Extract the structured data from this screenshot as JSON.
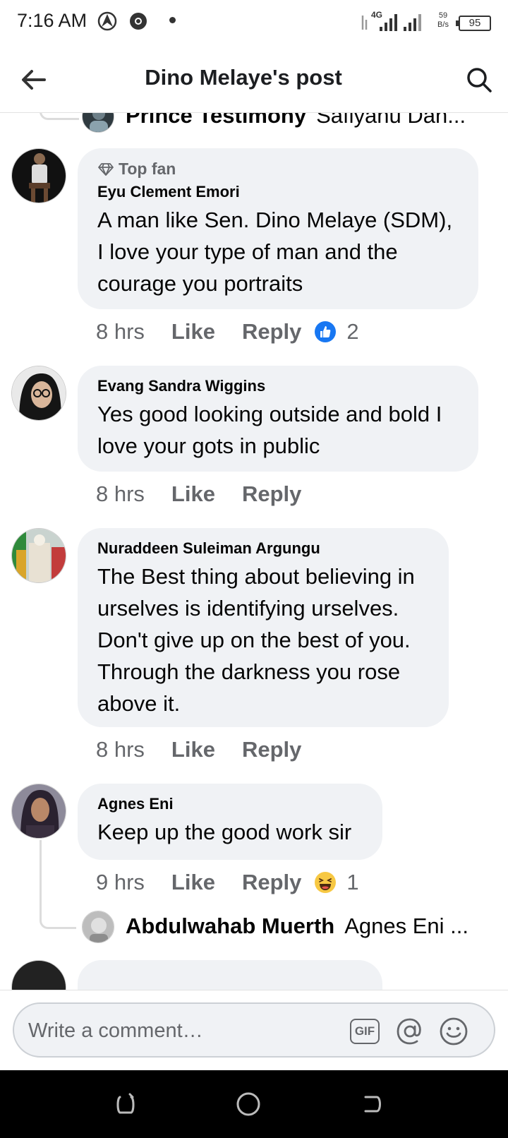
{
  "status_bar": {
    "time": "7:16 AM",
    "network": "4G",
    "speed_value": "59",
    "speed_unit": "B/s",
    "battery": "95"
  },
  "header": {
    "title": "Dino Melaye's post",
    "back_icon": "arrow-left-icon",
    "search_icon": "search-icon"
  },
  "reply_top": {
    "name": "Prince Testimony",
    "text": "Safiyanu Dan..."
  },
  "comments": [
    {
      "badge": "Top fan",
      "author": "Eyu Clement Emori",
      "lines": [
        "A man like Sen. Dino Melaye (SDM),",
        "I love your type of man and the",
        "courage you portraits"
      ],
      "time": "8 hrs",
      "like": "Like",
      "reply": "Reply",
      "reaction": "like",
      "reaction_count": "2"
    },
    {
      "author": "Evang Sandra Wiggins",
      "lines": [
        "Yes good looking outside and bold I",
        "love your gots in public"
      ],
      "time": "8 hrs",
      "like": "Like",
      "reply": "Reply"
    },
    {
      "author": "Nuraddeen Suleiman Argungu",
      "lines": [
        "The Best thing about believing in",
        "urselves is identifying urselves.",
        "Don't give up on the best of you.",
        "Through the darkness you rose",
        "above it."
      ],
      "time": "8 hrs",
      "like": "Like",
      "reply": "Reply"
    },
    {
      "author": "Agnes Eni",
      "lines": [
        "Keep up the good work sir"
      ],
      "time": "9 hrs",
      "like": "Like",
      "reply": "Reply",
      "reaction": "haha",
      "reaction_count": "1"
    }
  ],
  "reply_bottom": {
    "name": "Abdulwahab Muerth",
    "text": "Agnes Eni ..."
  },
  "composer": {
    "placeholder": "Write a comment…",
    "gif_label": "GIF"
  },
  "colors": {
    "accent": "#1877f2",
    "bubble": "#f0f2f5",
    "meta": "#65676b"
  }
}
